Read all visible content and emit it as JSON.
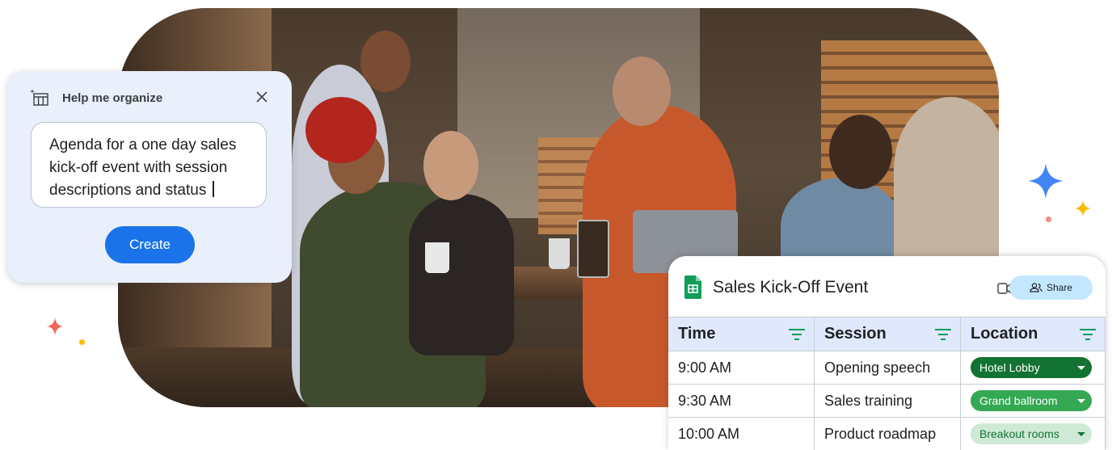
{
  "help_card": {
    "title": "Help me organize",
    "prompt_text": "Agenda for a one day sales kick-off event with session descriptions and status",
    "create_label": "Create"
  },
  "sheet": {
    "title": "Sales Kick-Off Event",
    "share_label": "Share",
    "columns": [
      "Time",
      "Session",
      "Location"
    ],
    "rows": [
      {
        "time": "9:00 AM",
        "session": "Opening speech",
        "location": "Hotel Lobby",
        "chip_bg": "#137333",
        "chip_fg": "#ffffff"
      },
      {
        "time": "9:30 AM",
        "session": "Sales training",
        "location": "Grand ballroom",
        "chip_bg": "#34a853",
        "chip_fg": "#ffffff"
      },
      {
        "time": "10:00 AM",
        "session": "Product roadmap",
        "location": "Breakout rooms",
        "chip_bg": "#ceead6",
        "chip_fg": "#137333"
      }
    ]
  },
  "colors": {
    "accent_blue": "#1a73e8",
    "card_bg": "#e9effb",
    "header_bg": "#dfe9fb",
    "share_bg": "#c2e7ff",
    "sparkle_blue": "#4285f4",
    "sparkle_yellow": "#fbbc04",
    "sparkle_red": "#ea4335",
    "sheets_green": "#0f9d58"
  }
}
